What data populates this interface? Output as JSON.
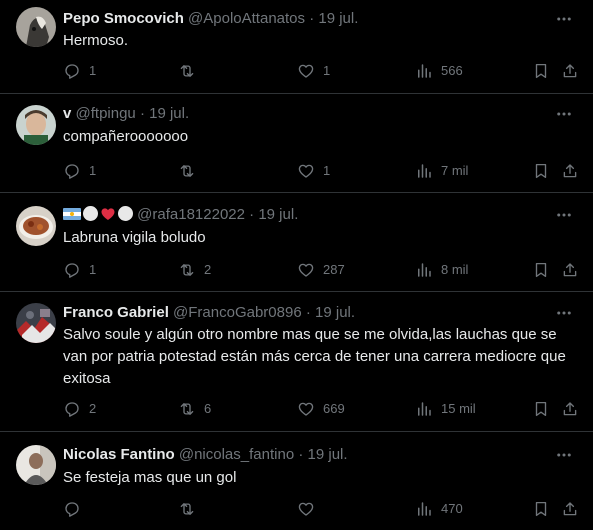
{
  "colors": {
    "background": "#000000",
    "text": "#e7e9ea",
    "secondary": "#71767b",
    "divider": "#2f3336"
  },
  "icons": {
    "reply": "reply-icon",
    "retweet": "retweet-icon",
    "like": "heart-icon",
    "views": "views-icon",
    "bookmark": "bookmark-icon",
    "share": "share-icon",
    "more": "more-icon"
  },
  "tweets": [
    {
      "name": "Pepo Smocovich",
      "handle": "@ApoloAttanatos",
      "dot": "·",
      "date": "19 jul.",
      "text": "Hermoso.",
      "replies": "1",
      "retweets": "",
      "likes": "1",
      "views": "566"
    },
    {
      "name": "v",
      "handle": "@ftpingu",
      "dot": "·",
      "date": "19 jul.",
      "text": "compañerooooooo",
      "replies": "1",
      "retweets": "",
      "likes": "1",
      "views": "7 mil"
    },
    {
      "name_emoji": [
        "argentina-flag",
        "white-circle",
        "red-heart",
        "white-circle"
      ],
      "handle": "@rafa18122022",
      "dot": "·",
      "date": "19 jul.",
      "text": "Labruna vigila boludo",
      "replies": "1",
      "retweets": "2",
      "likes": "287",
      "views": "8 mil"
    },
    {
      "name": "Franco Gabriel",
      "handle": "@FrancoGabr0896",
      "dot": "·",
      "date": "19 jul.",
      "text": "Salvo soule y algún otro nombre mas que se me olvida,las lauchas que se van por patria potestad están más cerca de tener una carrera mediocre que exitosa",
      "replies": "2",
      "retweets": "6",
      "likes": "669",
      "views": "15 mil"
    },
    {
      "name": "Nicolas Fantino",
      "handle": "@nicolas_fantino",
      "dot": "·",
      "date": "19 jul.",
      "text": "Se festeja mas que un gol",
      "replies": "",
      "retweets": "",
      "likes": "",
      "views": "470"
    }
  ]
}
